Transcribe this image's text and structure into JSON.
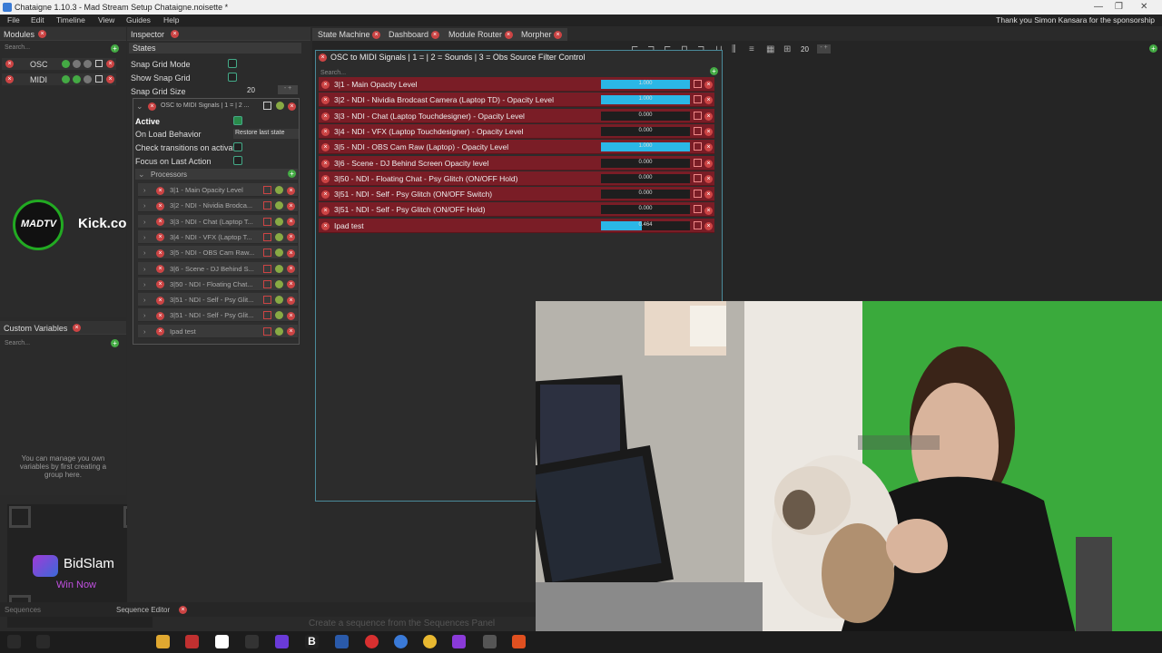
{
  "window": {
    "title": "Chataigne 1.10.3 - Mad Stream Setup Chataigne.noisette *",
    "sponsor": "Thank you Simon Kansara for the sponsorship"
  },
  "menu": [
    "File",
    "Edit",
    "Timeline",
    "View",
    "Guides",
    "Help"
  ],
  "modules": {
    "title": "Modules",
    "search_placeholder": "Search...",
    "items": [
      {
        "label": "OSC"
      },
      {
        "label": "MIDI"
      }
    ]
  },
  "custom_variables": {
    "title": "Custom Variables",
    "search_placeholder": "Search...",
    "hint": "You can manage you own variables by first creating a group here."
  },
  "overlay": {
    "kick_text": "Kick.com/MadTV",
    "kick_logo_text": "MADTV",
    "bidslam_name": "BidSlam",
    "bidslam_sub": "Win Now"
  },
  "inspector": {
    "title": "Inspector",
    "states_header": "States",
    "snap_grid_mode": "Snap Grid Mode",
    "show_snap_grid": "Show Snap Grid",
    "snap_grid_size": "Snap Grid Size",
    "snap_grid_size_value": "20",
    "mapping_header": "OSC to MIDI Signals | 1 = | 2 ...",
    "active_label": "Active",
    "on_load_label": "On Load Behavior",
    "on_load_value": "Restore last state",
    "check_transitions": "Check transitions on activate",
    "focus_last": "Focus on Last Action",
    "processors_header": "Processors",
    "processors": [
      "3|1 - Main Opacity Level",
      "3|2 - NDI - Nividia Brodca...",
      "3|3 - NDI - Chat (Laptop T...",
      "3|4 - NDI - VFX (Laptop T...",
      "3|5 - NDI - OBS Cam Raw...",
      "3|6 - Scene - DJ Behind S...",
      "3|50 - NDI - Floating Chat...",
      "3|51 - NDI - Self - Psy Glit...",
      "3|51 - NDI - Self - Psy Glit...",
      "Ipad test"
    ]
  },
  "editor_tabs": [
    "State Machine",
    "Dashboard",
    "Module Router",
    "Morpher"
  ],
  "toolbar": {
    "grid_value": "20"
  },
  "state_node": {
    "title": "OSC to MIDI Signals | 1 =  | 2 = Sounds | 3 = Obs Source Filter Control",
    "search_placeholder": "Search...",
    "mappings": [
      {
        "label": "3|1 - Main Opacity Level",
        "value": 1.0,
        "value_text": "1.000"
      },
      {
        "label": "3|2 - NDI - Nividia Brodcast Camera (Laptop TD) - Opacity Level",
        "value": 1.0,
        "value_text": "1.000"
      },
      {
        "label": "3|3 - NDI - Chat (Laptop Touchdesigner) - Opacity Level",
        "value": 0.0,
        "value_text": "0.000"
      },
      {
        "label": "3|4 - NDI - VFX (Laptop Touchdesigner) - Opacity Level",
        "value": 0.0,
        "value_text": "0.000"
      },
      {
        "label": "3|5 - NDI - OBS Cam Raw (Laptop) - Opacity Level",
        "value": 1.0,
        "value_text": "1.000"
      },
      {
        "label": "3|6 - Scene - DJ Behind Screen Opacity level",
        "value": 0.0,
        "value_text": "0.000"
      },
      {
        "label": "3|50 - NDI - Floating Chat - Psy Glitch (ON/OFF Hold)",
        "value": 0.0,
        "value_text": "0.000"
      },
      {
        "label": "3|51 - NDI - Self - Psy Glitch (ON/OFF Switch)",
        "value": 0.0,
        "value_text": "0.000"
      },
      {
        "label": "3|51 - NDI - Self - Psy Glitch (ON/OFF Hold)",
        "value": 0.0,
        "value_text": "0.000"
      },
      {
        "label": "Ipad test",
        "value": 0.464,
        "value_text": "0.464"
      }
    ]
  },
  "sequences": {
    "tab1": "Sequences",
    "tab2": "Sequence Editor",
    "hint": "Create a sequence from the Sequences Panel"
  },
  "colors": {
    "accent_bar": "#2bb7e6",
    "mapping_row": "#7a1d26",
    "green": "#2a8a4a"
  }
}
